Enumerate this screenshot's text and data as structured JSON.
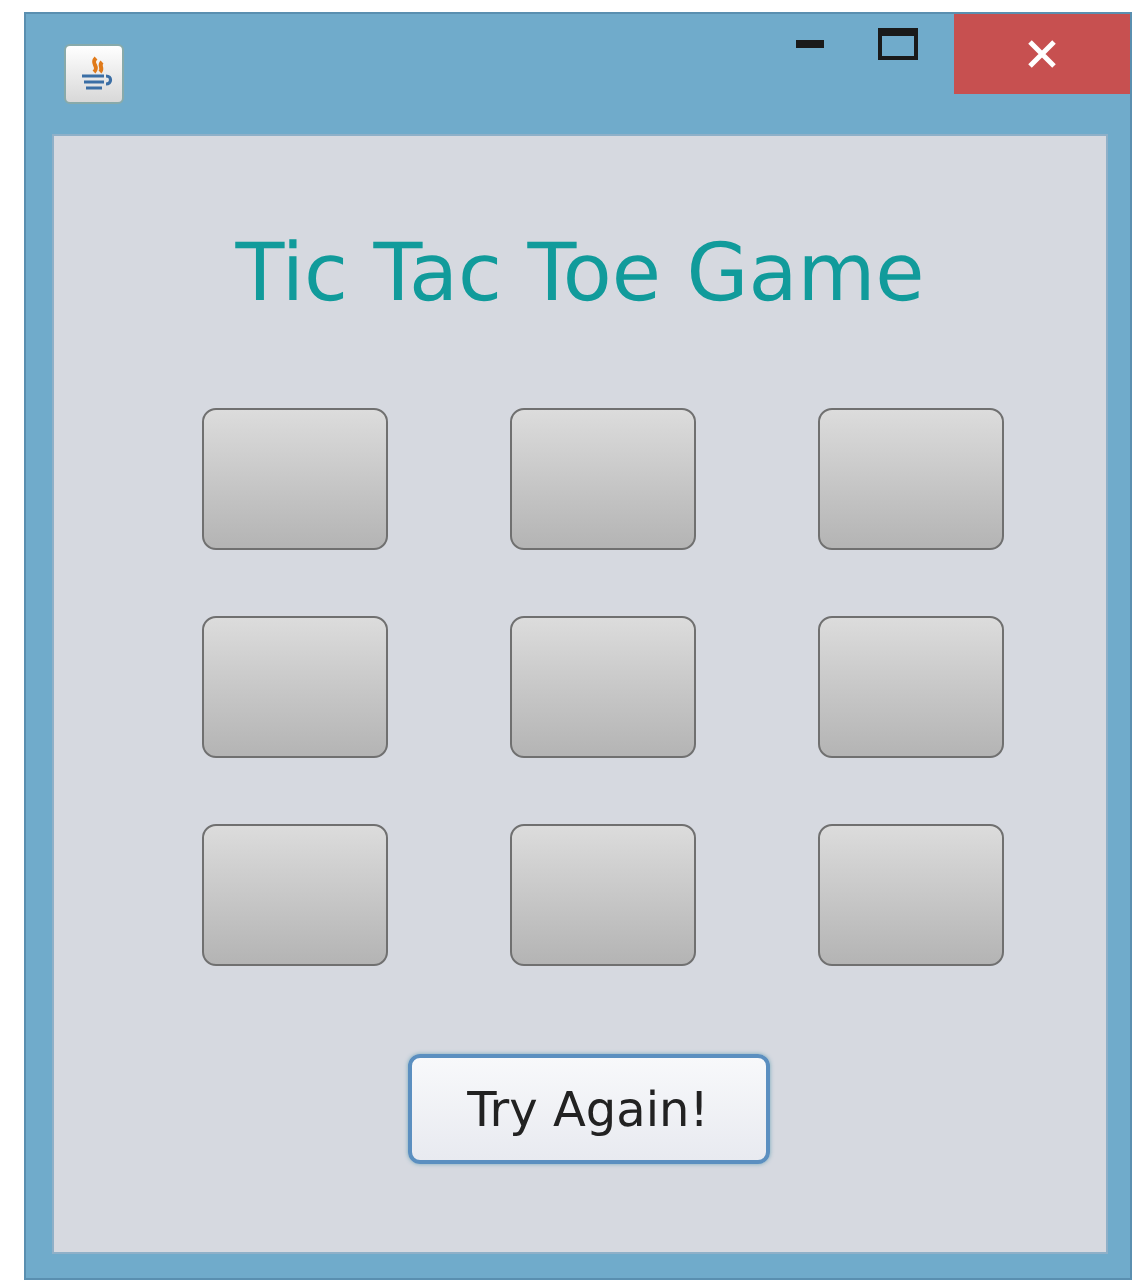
{
  "window": {
    "controls": [
      {
        "kind": "minimize"
      },
      {
        "kind": "maximize"
      },
      {
        "kind": "close"
      }
    ]
  },
  "title": "Tic Tac Toe Game",
  "cells": [
    {
      "kind": "empty"
    },
    {
      "kind": "empty"
    },
    {
      "kind": "empty"
    },
    {
      "kind": "empty"
    },
    {
      "kind": "empty"
    },
    {
      "kind": "empty"
    },
    {
      "kind": "empty"
    },
    {
      "kind": "empty"
    },
    {
      "kind": "empty"
    }
  ],
  "button": "Try Again!"
}
